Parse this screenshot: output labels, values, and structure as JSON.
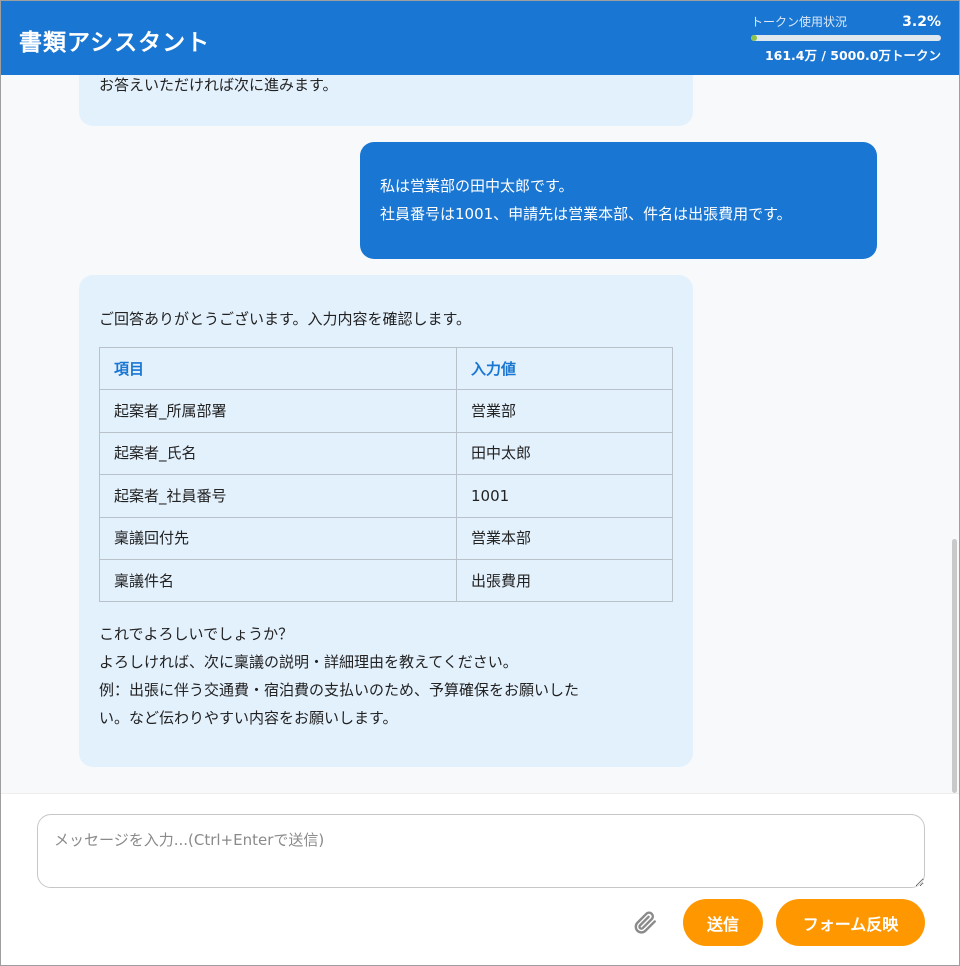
{
  "header": {
    "title": "書類アシスタント",
    "token_label": "トークン使用状況",
    "token_percent": "3.2%",
    "token_fraction": 0.032,
    "token_count": "161.4万 / 5000.0万トークン"
  },
  "messages": {
    "bot1_text": "お答えいただければ次に進みます。",
    "user1_line1": "私は営業部の田中太郎です。",
    "user1_line2": "社員番号は1001、申請先は営業本部、件名は出張費用です。",
    "bot2_intro": "ご回答ありがとうございます。入力内容を確認します。",
    "table": {
      "headers": [
        "項目",
        "入力値"
      ],
      "rows": [
        [
          "起案者_所属部署",
          "営業部"
        ],
        [
          "起案者_氏名",
          "田中太郎"
        ],
        [
          "起案者_社員番号",
          "1001"
        ],
        [
          "稟議回付先",
          "営業本部"
        ],
        [
          "稟議件名",
          "出張費用"
        ]
      ]
    },
    "bot2_outro": [
      "これでよろしいでしょうか？",
      "よろしければ、次に稟議の説明・詳細理由を教えてください。",
      "例：出張に伴う交通費・宿泊費の支払いのため、予算確保をお願いした",
      "い。など伝わりやすい内容をお願いします。"
    ]
  },
  "input": {
    "placeholder": "メッセージを入力...(Ctrl+Enterで送信)",
    "value": ""
  },
  "buttons": {
    "attach_icon": "paperclip-icon",
    "send_label": "送信",
    "form_label": "フォーム反映"
  },
  "colors": {
    "primary": "#1976d2",
    "accent": "#ff9800",
    "bot_bubble": "#e3f1fd",
    "token_fill": "#8bc34a"
  }
}
